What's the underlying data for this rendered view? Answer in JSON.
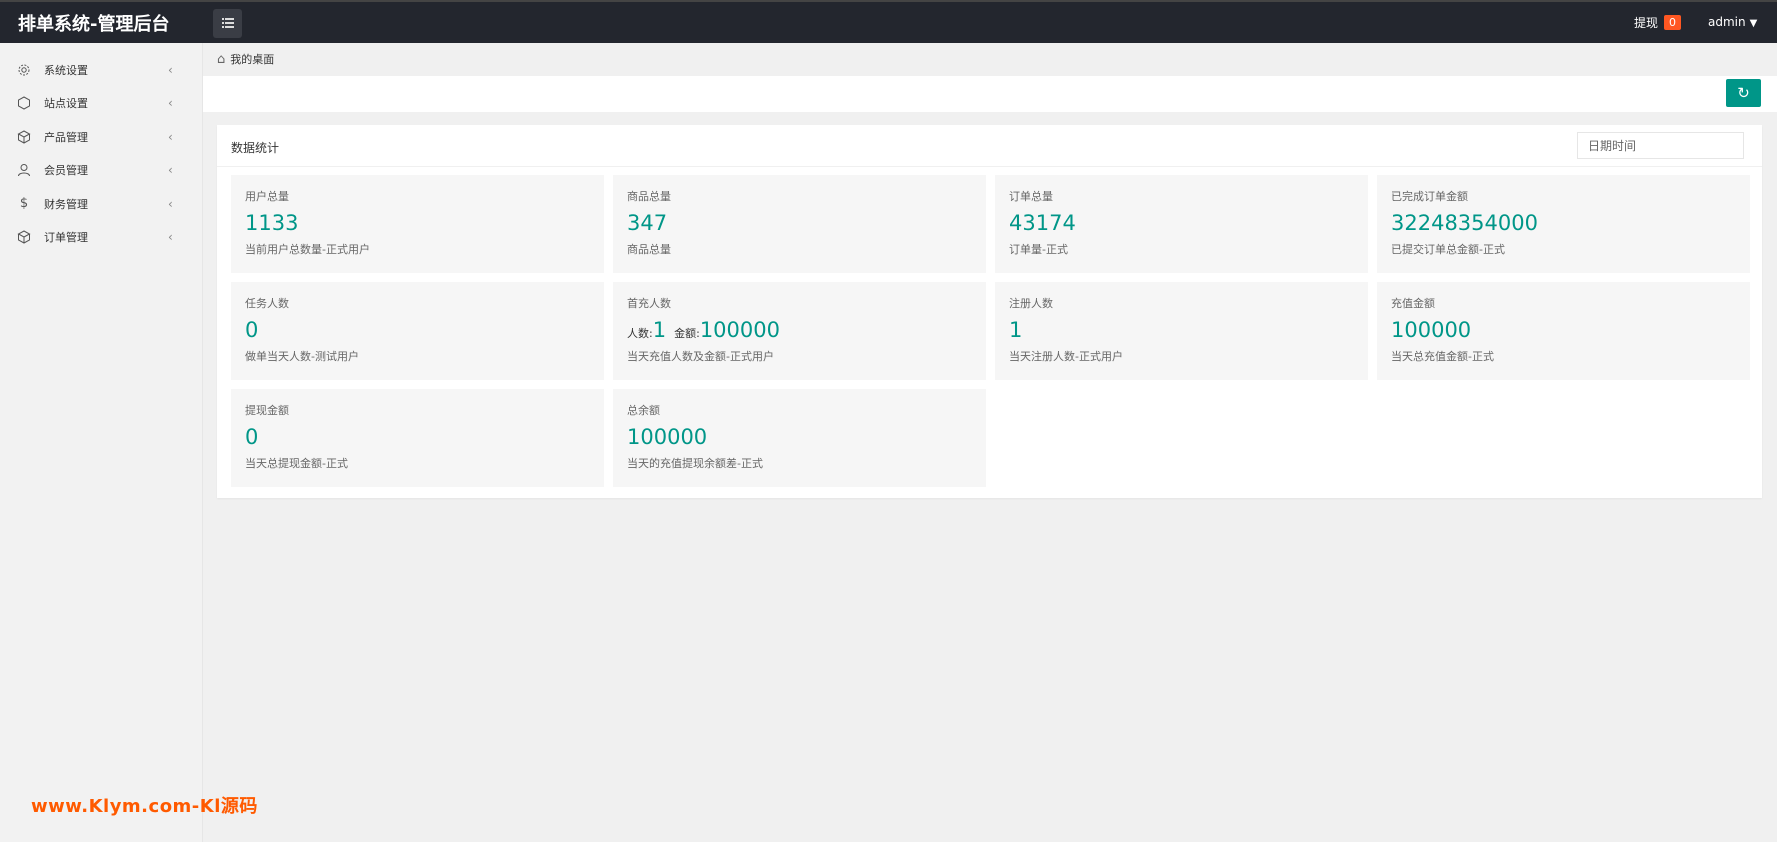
{
  "topbar": {
    "brand": "排单系统-管理后台",
    "menu_toggle_icon": "list-icon",
    "withdraw_label": "提现",
    "withdraw_badge": "0",
    "user_name": "admin"
  },
  "sidebar": {
    "items": [
      {
        "label": "系统设置",
        "icon": "gear-icon"
      },
      {
        "label": "站点设置",
        "icon": "hexagon-icon"
      },
      {
        "label": "产品管理",
        "icon": "cube-icon"
      },
      {
        "label": "会员管理",
        "icon": "user-icon"
      },
      {
        "label": "财务管理",
        "icon": "dollar-icon"
      },
      {
        "label": "订单管理",
        "icon": "cube-icon"
      }
    ]
  },
  "breadcrumb": {
    "label": "我的桌面"
  },
  "panel": {
    "title": "数据统计",
    "date_placeholder": "日期时间"
  },
  "cards": [
    {
      "label": "用户总量",
      "value": "1133",
      "desc": "当前用户总数量-正式用户"
    },
    {
      "label": "商品总量",
      "value": "347",
      "desc": "商品总量"
    },
    {
      "label": "订单总量",
      "value": "43174",
      "desc": "订单量-正式"
    },
    {
      "label": "已完成订单金额",
      "value": "32248354000",
      "desc": "已提交订单总金额-正式"
    },
    {
      "label": "任务人数",
      "value": "0",
      "desc": "做单当天人数-测试用户"
    },
    {
      "label": "首充人数",
      "people_prefix": "人数:",
      "people_value": "1",
      "amount_prefix": "金额:",
      "amount_value": "100000",
      "desc": "当天充值人数及金额-正式用户"
    },
    {
      "label": "注册人数",
      "value": "1",
      "desc": "当天注册人数-正式用户"
    },
    {
      "label": "充值金额",
      "value": "100000",
      "desc": "当天总充值金额-正式"
    },
    {
      "label": "提现金额",
      "value": "0",
      "desc": "当天总提现金额-正式"
    },
    {
      "label": "总余额",
      "value": "100000",
      "desc": "当天的充值提现余额差-正式"
    }
  ],
  "watermark": "www.Klym.com-Kl源码",
  "colors": {
    "accent": "#009688",
    "topbar": "#23262e",
    "badge": "#ff5722",
    "watermark": "#ff5a00"
  }
}
